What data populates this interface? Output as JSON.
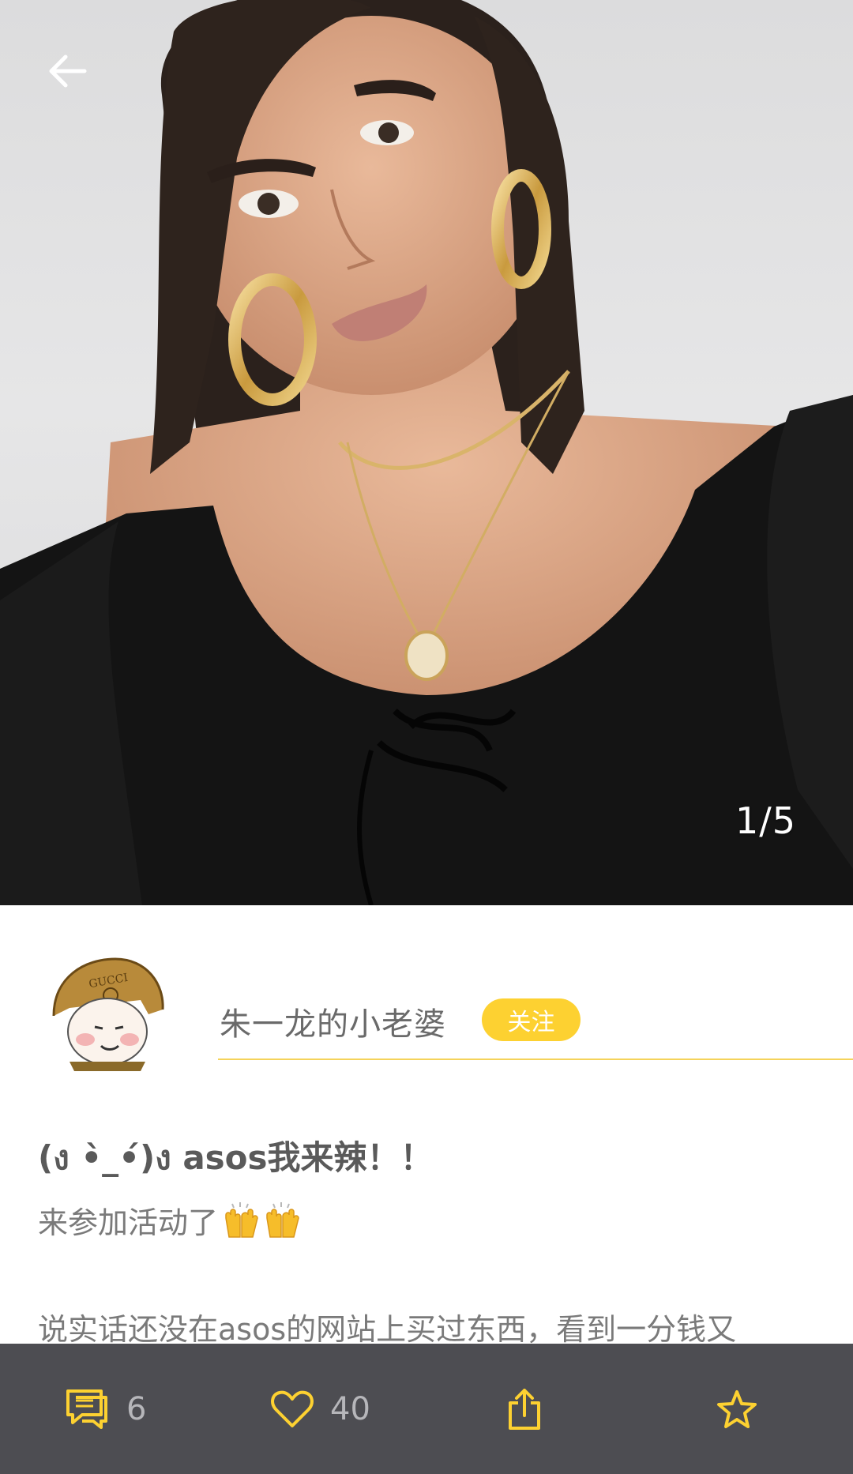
{
  "header": {
    "image_counter": "1/5",
    "back_icon": "arrow-left-icon"
  },
  "author": {
    "nickname": "朱一龙的小老婆",
    "follow_label": "关注",
    "avatar_badge_text": "GUCCI",
    "accent_color": "#fdd131"
  },
  "post": {
    "title": "(ง •̀_•́)ง asos我来辣！！",
    "line1": "来参加活动了",
    "line1_emoji": "raising-hands-emoji",
    "line2": "说实话还没在asos的网站上买过东西，看到一分钱又"
  },
  "bottom_bar": {
    "comment_count": "6",
    "like_count": "40",
    "icons": [
      "comment-icon",
      "heart-icon",
      "share-icon",
      "star-icon"
    ],
    "icon_color": "#fdd131",
    "background": "#4d4d52"
  }
}
